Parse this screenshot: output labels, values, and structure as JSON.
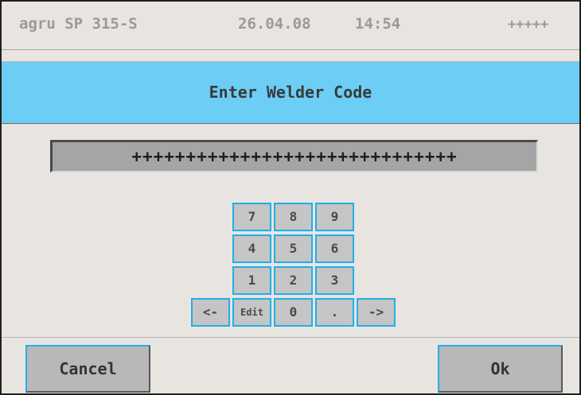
{
  "status_bar": {
    "model": "agru SP 315-S",
    "date": "26.04.08",
    "time": "14:54",
    "indicator": "+++++"
  },
  "dialog": {
    "title": "Enter Welder Code",
    "code_value": "++++++++++++++++++++++++++++++"
  },
  "keypad": {
    "keys": [
      {
        "label": "7"
      },
      {
        "label": "8"
      },
      {
        "label": "9"
      },
      {
        "label": "4"
      },
      {
        "label": "5"
      },
      {
        "label": "6"
      },
      {
        "label": "1"
      },
      {
        "label": "2"
      },
      {
        "label": "3"
      },
      {
        "label": "<-"
      },
      {
        "label": "Edit"
      },
      {
        "label": "0"
      },
      {
        "label": "."
      },
      {
        "label": "->"
      }
    ]
  },
  "actions": {
    "cancel_label": "Cancel",
    "ok_label": "Ok"
  },
  "colors": {
    "title_background": "#6ccdf5",
    "key_border": "#22aee8",
    "screen_background": "#e8e5e1",
    "field_background": "#a5a5a5"
  }
}
